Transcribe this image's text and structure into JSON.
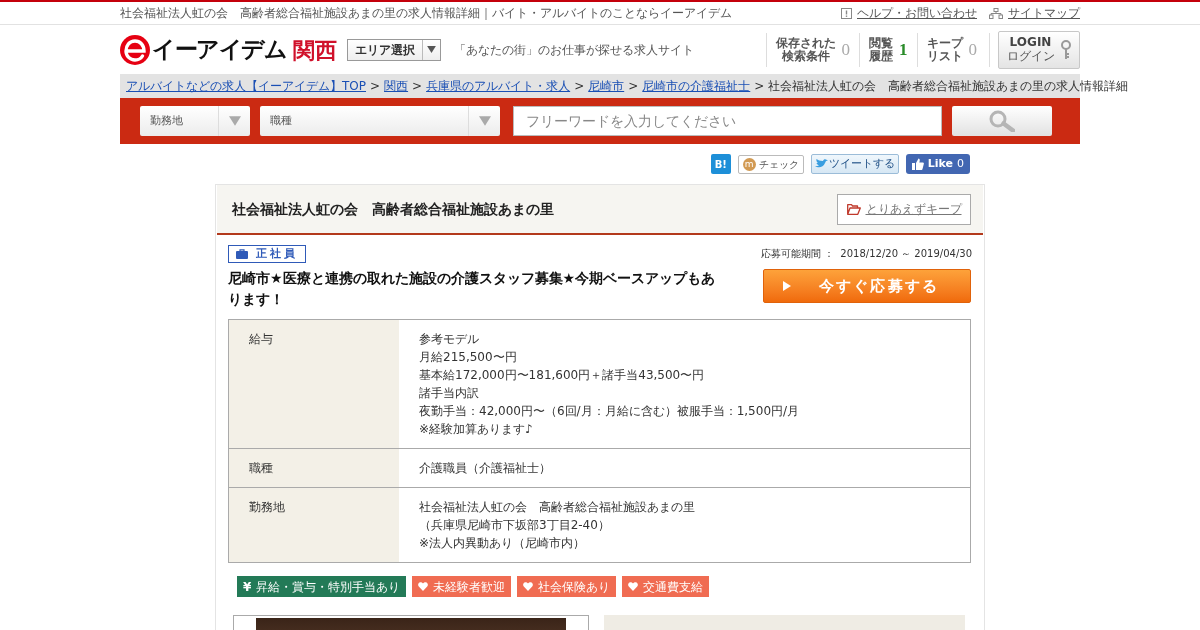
{
  "top_bar": {
    "page_title": "社会福祉法人虹の会　高齢者総合福祉施設あまの里の求人情報詳細｜バイト・アルバイトのことならイーアイデム",
    "links": [
      {
        "kind": "help",
        "label": "ヘルプ・お問い合わせ"
      },
      {
        "kind": "sitemap",
        "label": "サイトマップ"
      }
    ]
  },
  "header": {
    "logo": {
      "name": "イーアイデム",
      "region": "関西"
    },
    "area_select": "エリア選択",
    "tagline": "「あなたの街」のお仕事が探せる求人サイト",
    "counters": [
      {
        "label_lines": [
          "保存された",
          "検索条件"
        ],
        "count": "0",
        "highlighted": false
      },
      {
        "label_lines": [
          "閲覧",
          "履歴"
        ],
        "count": "1",
        "highlighted": true
      },
      {
        "label_lines": [
          "キープ",
          "リスト"
        ],
        "count": "0",
        "highlighted": false
      }
    ],
    "login": {
      "label": "LOGIN",
      "sublabel": "ログイン"
    }
  },
  "breadcrumb": {
    "separator": ">",
    "items": [
      {
        "label": "アルバイトなどの求人【イーアイデム】TOP",
        "link": true
      },
      {
        "label": "関西",
        "link": true
      },
      {
        "label": "兵庫県のアルバイト・求人",
        "link": true
      },
      {
        "label": "尼崎市",
        "link": true
      },
      {
        "label": "尼崎市の介護福祉士",
        "link": true
      },
      {
        "label": "社会福祉法人虹の会　高齢者総合福祉施設あまの里の求人情報詳細",
        "link": false
      }
    ]
  },
  "search": {
    "selects": [
      {
        "label": "勤務地"
      },
      {
        "label": "職種"
      }
    ],
    "keyword": {
      "placeholder": "フリーワードを入力してください"
    }
  },
  "share_buttons": [
    {
      "kind": "hatena",
      "label": "B!"
    },
    {
      "kind": "check",
      "badge": "m",
      "label": "チェック"
    },
    {
      "kind": "tweet",
      "label": "ツイートする"
    },
    {
      "kind": "like",
      "label": "Like",
      "count": "0"
    }
  ],
  "job": {
    "company": "社会福祉法人虹の会　高齢者総合福祉施設あまの里",
    "keep_button": "とりあえずキープ",
    "employment_type": "正社員",
    "period": "応募可能期間 ：  2018/12/20 ～ 2019/04/30",
    "title": "尼崎市★医療と連携の取れた施設の介護スタッフ募集★今期ベースアップもあります！",
    "apply_button": "今すぐ応募する",
    "details": [
      {
        "heading": "給与",
        "lines": [
          "参考モデル",
          "月給215,500〜円",
          "基本給172,000円〜181,600円＋諸手当43,500〜円",
          "諸手当内訳",
          "夜勤手当：42,000円〜（6回/月：月給に含む）被服手当：1,500円/月",
          "※経験加算あります♪"
        ]
      },
      {
        "heading": "職種",
        "lines": [
          "介護職員（介護福祉士）"
        ]
      },
      {
        "heading": "勤務地",
        "lines": [
          "社会福祉法人虹の会　高齢者総合福祉施設あまの里",
          "（兵庫県尼崎市下坂部3丁目2-40）",
          "※法人内異動あり（尼崎市内）"
        ]
      }
    ],
    "tags": [
      {
        "kind": "yen",
        "symbol": "¥",
        "label": "昇給・賞与・特別手当あり",
        "color": "#237a57"
      },
      {
        "kind": "heart",
        "label": "未経験者歓迎",
        "color": "#f06c52"
      },
      {
        "kind": "heart",
        "label": "社会保険あり",
        "color": "#f06c52"
      },
      {
        "kind": "heart",
        "label": "交通費支給",
        "color": "#f06c52"
      }
    ]
  }
}
